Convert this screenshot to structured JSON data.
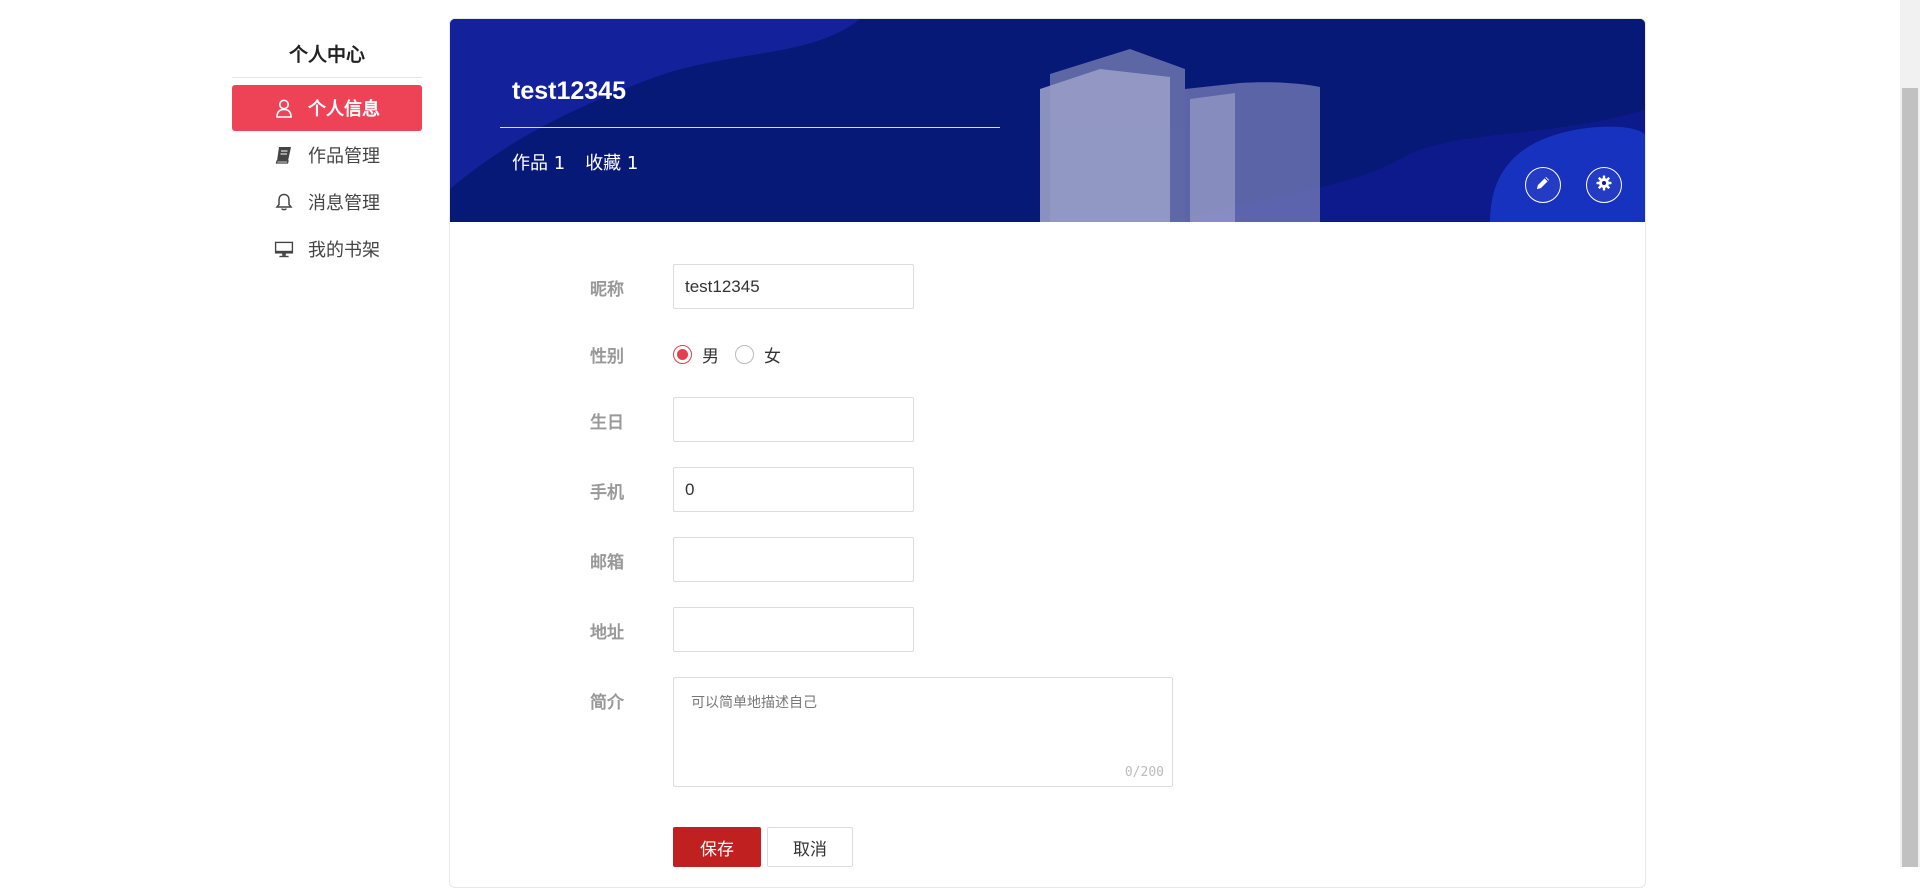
{
  "sidebar": {
    "title": "个人中心",
    "items": [
      {
        "label": "个人信息",
        "icon": "user-icon",
        "active": true
      },
      {
        "label": "作品管理",
        "icon": "book-icon",
        "active": false
      },
      {
        "label": "消息管理",
        "icon": "bell-icon",
        "active": false
      },
      {
        "label": "我的书架",
        "icon": "monitor-icon",
        "active": false
      }
    ]
  },
  "banner": {
    "user_name": "test12345",
    "works_label": "作品 1",
    "favorites_label": "收藏 1",
    "edit_icon": "pencil-icon",
    "settings_icon": "gear-icon",
    "background_color": "#0d1a8f"
  },
  "form": {
    "nickname": {
      "label": "昵称",
      "value": "test12345"
    },
    "gender": {
      "label": "性别",
      "options": [
        "男",
        "女"
      ],
      "selected": "男"
    },
    "birthday": {
      "label": "生日",
      "value": ""
    },
    "phone": {
      "label": "手机",
      "value": "0"
    },
    "email": {
      "label": "邮箱",
      "value": ""
    },
    "address": {
      "label": "地址",
      "value": ""
    },
    "bio": {
      "label": "简介",
      "placeholder": "可以简单地描述自己",
      "value": "",
      "count": "0/200"
    },
    "save_label": "保存",
    "cancel_label": "取消"
  },
  "colors": {
    "accent": "#ee4257",
    "save_button": "#c0201f",
    "radio_checked": "#e04050"
  }
}
